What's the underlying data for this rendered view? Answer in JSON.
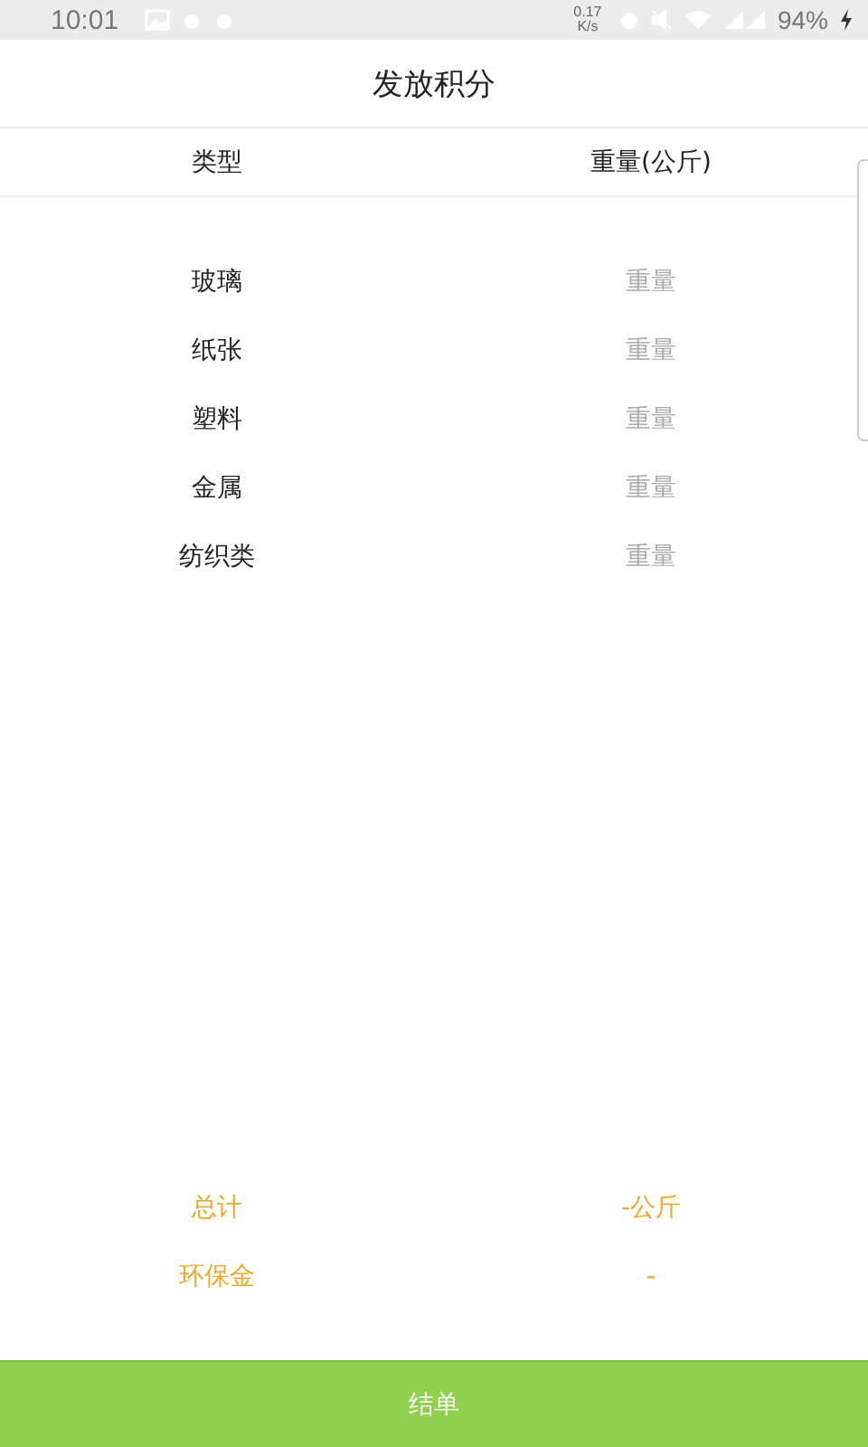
{
  "status_bar": {
    "time": "10:01",
    "net_speed": "0.17 K/s",
    "battery": "94%"
  },
  "title": "发放积分",
  "table": {
    "columns": [
      "类型",
      "重量(公斤)"
    ],
    "rows": [
      {
        "type": "玻璃",
        "placeholder": "重量"
      },
      {
        "type": "纸张",
        "placeholder": "重量"
      },
      {
        "type": "塑料",
        "placeholder": "重量"
      },
      {
        "type": "金属",
        "placeholder": "重量"
      },
      {
        "type": "纺织类",
        "placeholder": "重量"
      }
    ]
  },
  "summary": [
    {
      "label": "总计",
      "value": "-公斤"
    },
    {
      "label": "环保金",
      "value": "-"
    }
  ],
  "submit_button": "结单"
}
